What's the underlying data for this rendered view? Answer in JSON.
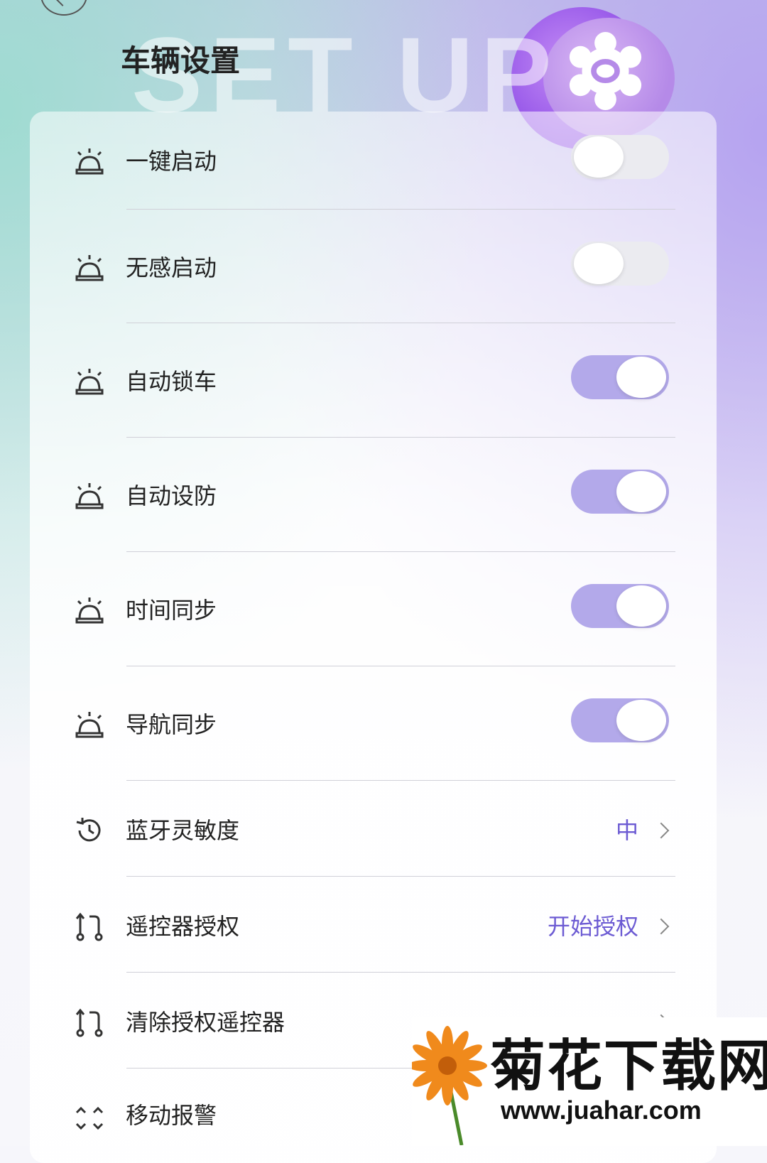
{
  "header": {
    "title": "车辆设置",
    "background_text": "SET UP",
    "back_icon": "chevron-left-icon",
    "decor_icon": "gear-icon"
  },
  "settings": {
    "toggles": [
      {
        "label": "一键启动",
        "icon": "alarm-light-icon",
        "on": false
      },
      {
        "label": "无感启动",
        "icon": "alarm-light-icon",
        "on": false
      },
      {
        "label": "自动锁车",
        "icon": "alarm-light-icon",
        "on": true
      },
      {
        "label": "自动设防",
        "icon": "alarm-light-icon",
        "on": true
      },
      {
        "label": "时间同步",
        "icon": "alarm-light-icon",
        "on": true
      },
      {
        "label": "导航同步",
        "icon": "alarm-light-icon",
        "on": true
      }
    ],
    "links": [
      {
        "label": "蓝牙灵敏度",
        "value": "中",
        "icon": "bluetooth-sensitivity-icon"
      },
      {
        "label": "遥控器授权",
        "value": "开始授权",
        "icon": "remote-auth-icon"
      },
      {
        "label": "清除授权遥控器",
        "value": "",
        "icon": "remote-auth-icon"
      },
      {
        "label": "移动报警",
        "value": "",
        "icon": "motion-alarm-icon"
      }
    ]
  },
  "watermark": {
    "title": "菊花下载网",
    "url": "www.juahar.com"
  },
  "colors": {
    "toggle_on": "#b3a9ea",
    "toggle_off": "#ebebf0",
    "accent_text": "#6c5bd3"
  }
}
